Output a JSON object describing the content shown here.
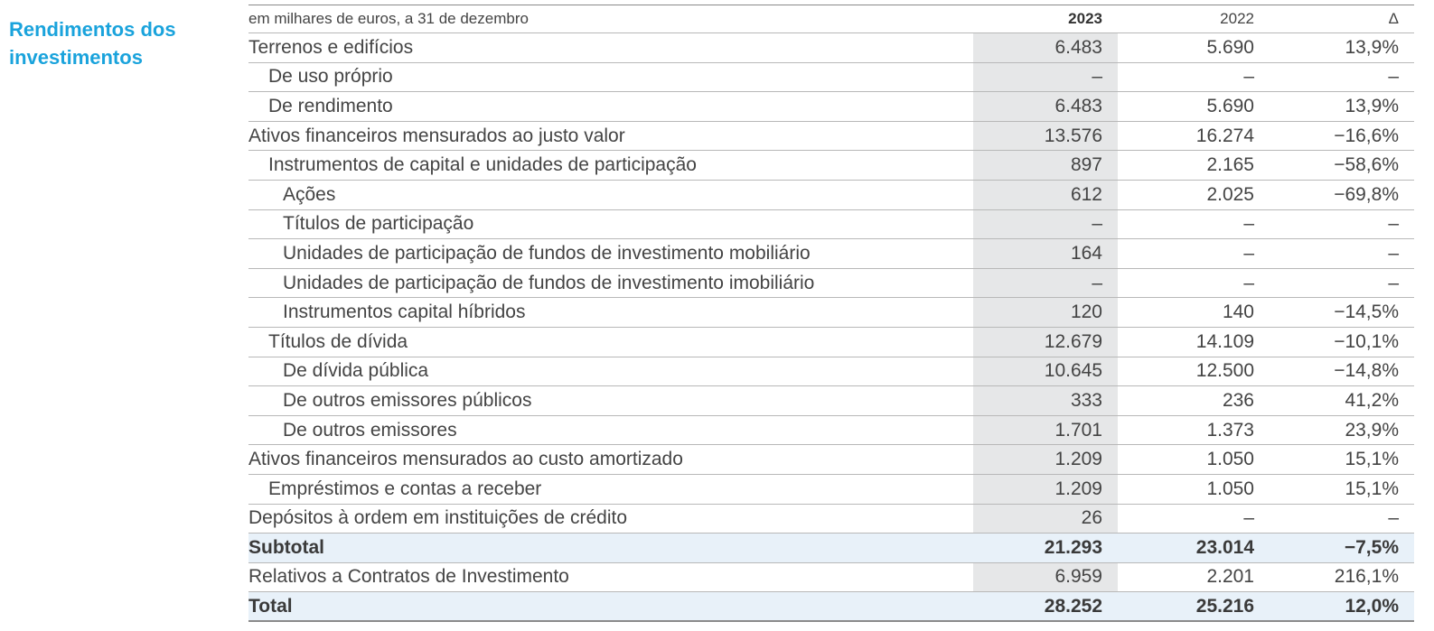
{
  "section_title": "Rendimentos dos investimentos",
  "header": {
    "label": "em milhares de euros, a 31 de dezembro",
    "y2023": "2023",
    "y2022": "2022",
    "delta": "Δ"
  },
  "rows": [
    {
      "label": "Terrenos e edifícios",
      "v2023": "6.483",
      "v2022": "5.690",
      "delta": "13,9%",
      "indent": 0
    },
    {
      "label": "De uso próprio",
      "v2023": "–",
      "v2022": "–",
      "delta": "–",
      "indent": 1
    },
    {
      "label": "De rendimento",
      "v2023": "6.483",
      "v2022": "5.690",
      "delta": "13,9%",
      "indent": 1
    },
    {
      "label": "Ativos financeiros mensurados ao justo valor",
      "v2023": "13.576",
      "v2022": "16.274",
      "delta": "−16,6%",
      "indent": 0
    },
    {
      "label": "Instrumentos de capital e unidades de participação",
      "v2023": "897",
      "v2022": "2.165",
      "delta": "−58,6%",
      "indent": 1
    },
    {
      "label": "Ações",
      "v2023": "612",
      "v2022": "2.025",
      "delta": "−69,8%",
      "indent": 2
    },
    {
      "label": "Títulos de participação",
      "v2023": "–",
      "v2022": "–",
      "delta": "–",
      "indent": 2
    },
    {
      "label": "Unidades de participação de fundos de investimento mobiliário",
      "v2023": "164",
      "v2022": "–",
      "delta": "–",
      "indent": 2
    },
    {
      "label": "Unidades de participação de fundos de investimento imobiliário",
      "v2023": "–",
      "v2022": "–",
      "delta": "–",
      "indent": 2
    },
    {
      "label": "Instrumentos capital híbridos",
      "v2023": "120",
      "v2022": "140",
      "delta": "−14,5%",
      "indent": 2
    },
    {
      "label": "Títulos de dívida",
      "v2023": "12.679",
      "v2022": "14.109",
      "delta": "−10,1%",
      "indent": 1
    },
    {
      "label": "De dívida pública",
      "v2023": "10.645",
      "v2022": "12.500",
      "delta": "−14,8%",
      "indent": 2
    },
    {
      "label": "De outros emissores públicos",
      "v2023": "333",
      "v2022": "236",
      "delta": "41,2%",
      "indent": 2
    },
    {
      "label": "De outros emissores",
      "v2023": "1.701",
      "v2022": "1.373",
      "delta": "23,9%",
      "indent": 2
    },
    {
      "label": "Ativos financeiros mensurados ao custo amortizado",
      "v2023": "1.209",
      "v2022": "1.050",
      "delta": "15,1%",
      "indent": 0
    },
    {
      "label": "Empréstimos e contas a receber",
      "v2023": "1.209",
      "v2022": "1.050",
      "delta": "15,1%",
      "indent": 1
    },
    {
      "label": "Depósitos à ordem em instituições de crédito",
      "v2023": "26",
      "v2022": "–",
      "delta": "–",
      "indent": 0
    },
    {
      "label": "Subtotal",
      "v2023": "21.293",
      "v2022": "23.014",
      "delta": "−7,5%",
      "indent": 0,
      "style": "subtotal"
    },
    {
      "label": "Relativos a Contratos de Investimento",
      "v2023": "6.959",
      "v2022": "2.201",
      "delta": "216,1%",
      "indent": 0
    },
    {
      "label": "Total",
      "v2023": "28.252",
      "v2022": "25.216",
      "delta": "12,0%",
      "indent": 0,
      "style": "total"
    }
  ]
}
